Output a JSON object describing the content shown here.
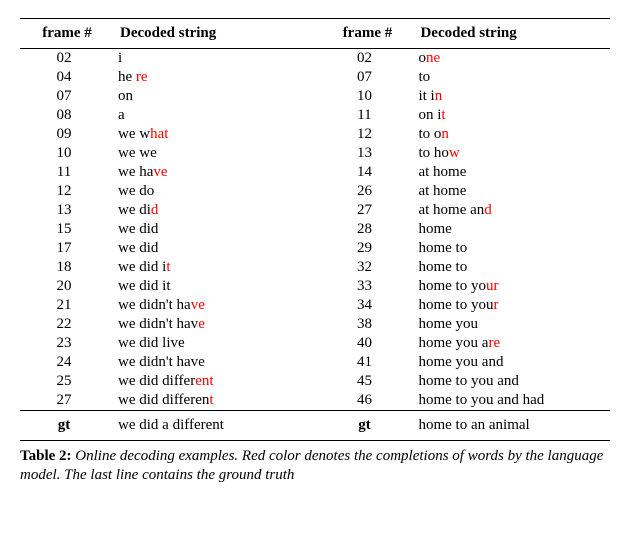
{
  "headers": {
    "frame": "frame #",
    "decoded": "Decoded string",
    "gt": "gt"
  },
  "left": [
    {
      "frame": "02",
      "parts": [
        [
          "i",
          false
        ]
      ]
    },
    {
      "frame": "04",
      "parts": [
        [
          "he ",
          false
        ],
        [
          "re",
          true
        ]
      ]
    },
    {
      "frame": "07",
      "parts": [
        [
          "on",
          false
        ]
      ]
    },
    {
      "frame": "08",
      "parts": [
        [
          "a",
          false
        ]
      ]
    },
    {
      "frame": "09",
      "parts": [
        [
          "we w",
          false
        ],
        [
          "hat",
          true
        ]
      ]
    },
    {
      "frame": "10",
      "parts": [
        [
          "we we",
          false
        ]
      ]
    },
    {
      "frame": "11",
      "parts": [
        [
          "we ha",
          false
        ],
        [
          "ve",
          true
        ]
      ]
    },
    {
      "frame": "12",
      "parts": [
        [
          "we do",
          false
        ]
      ]
    },
    {
      "frame": "13",
      "parts": [
        [
          "we di",
          false
        ],
        [
          "d",
          true
        ]
      ]
    },
    {
      "frame": "15",
      "parts": [
        [
          "we did",
          false
        ]
      ]
    },
    {
      "frame": "17",
      "parts": [
        [
          "we did",
          false
        ]
      ]
    },
    {
      "frame": "18",
      "parts": [
        [
          "we did i",
          false
        ],
        [
          "t",
          true
        ]
      ]
    },
    {
      "frame": "20",
      "parts": [
        [
          "we did it",
          false
        ]
      ]
    },
    {
      "frame": "21",
      "parts": [
        [
          "we didn't ha",
          false
        ],
        [
          "ve",
          true
        ]
      ]
    },
    {
      "frame": "22",
      "parts": [
        [
          "we didn't hav",
          false
        ],
        [
          "e",
          true
        ]
      ]
    },
    {
      "frame": "23",
      "parts": [
        [
          "we did live",
          false
        ]
      ]
    },
    {
      "frame": "24",
      "parts": [
        [
          "we didn't have",
          false
        ]
      ]
    },
    {
      "frame": "25",
      "parts": [
        [
          "we did differ",
          false
        ],
        [
          "ent",
          true
        ]
      ]
    },
    {
      "frame": "27",
      "parts": [
        [
          "we did differen",
          false
        ],
        [
          "t",
          true
        ]
      ]
    }
  ],
  "right": [
    {
      "frame": "02",
      "parts": [
        [
          "o",
          false
        ],
        [
          "ne",
          true
        ]
      ]
    },
    {
      "frame": "07",
      "parts": [
        [
          "to",
          false
        ]
      ]
    },
    {
      "frame": "10",
      "parts": [
        [
          "it i",
          false
        ],
        [
          "n",
          true
        ]
      ]
    },
    {
      "frame": "11",
      "parts": [
        [
          "on i",
          false
        ],
        [
          "t",
          true
        ]
      ]
    },
    {
      "frame": "12",
      "parts": [
        [
          "to o",
          false
        ],
        [
          "n",
          true
        ]
      ]
    },
    {
      "frame": "13",
      "parts": [
        [
          "to ho",
          false
        ],
        [
          "w",
          true
        ]
      ]
    },
    {
      "frame": "14",
      "parts": [
        [
          "at home",
          false
        ]
      ]
    },
    {
      "frame": "26",
      "parts": [
        [
          "at home",
          false
        ]
      ]
    },
    {
      "frame": "27",
      "parts": [
        [
          "at home an",
          false
        ],
        [
          "d",
          true
        ]
      ]
    },
    {
      "frame": "28",
      "parts": [
        [
          "home",
          false
        ]
      ]
    },
    {
      "frame": "29",
      "parts": [
        [
          "home to",
          false
        ]
      ]
    },
    {
      "frame": "32",
      "parts": [
        [
          "home to",
          false
        ]
      ]
    },
    {
      "frame": "33",
      "parts": [
        [
          "home to yo",
          false
        ],
        [
          "ur",
          true
        ]
      ]
    },
    {
      "frame": "34",
      "parts": [
        [
          "home to you",
          false
        ],
        [
          "r",
          true
        ]
      ]
    },
    {
      "frame": "38",
      "parts": [
        [
          "home you",
          false
        ]
      ]
    },
    {
      "frame": "40",
      "parts": [
        [
          "home you a",
          false
        ],
        [
          "re",
          true
        ]
      ]
    },
    {
      "frame": "41",
      "parts": [
        [
          "home you and",
          false
        ]
      ]
    },
    {
      "frame": "45",
      "parts": [
        [
          "home to you and",
          false
        ]
      ]
    },
    {
      "frame": "46",
      "parts": [
        [
          "home to you and had",
          false
        ]
      ]
    }
  ],
  "gt_left": "we did a different",
  "gt_right": "home to an animal",
  "caption": {
    "label": "Table 2:",
    "text": "Online decoding examples. Red color denotes the completions of words by the language model. The last line contains the ground truth"
  },
  "chart_data": {
    "type": "table",
    "title": "Online decoding examples",
    "columns": [
      "frame #",
      "Decoded string",
      "frame #",
      "Decoded string"
    ],
    "note": "Red color denotes language-model completions; last line is ground truth",
    "rows": [
      [
        "02",
        "i",
        "02",
        "one"
      ],
      [
        "04",
        "he re",
        "07",
        "to"
      ],
      [
        "07",
        "on",
        "10",
        "it in"
      ],
      [
        "08",
        "a",
        "11",
        "on it"
      ],
      [
        "09",
        "we what",
        "12",
        "to on"
      ],
      [
        "10",
        "we we",
        "13",
        "to how"
      ],
      [
        "11",
        "we have",
        "14",
        "at home"
      ],
      [
        "12",
        "we do",
        "26",
        "at home"
      ],
      [
        "13",
        "we did",
        "27",
        "at home and"
      ],
      [
        "15",
        "we did",
        "28",
        "home"
      ],
      [
        "17",
        "we did",
        "29",
        "home to"
      ],
      [
        "18",
        "we did it",
        "32",
        "home to"
      ],
      [
        "20",
        "we did it",
        "33",
        "home to your"
      ],
      [
        "21",
        "we didn't have",
        "34",
        "home to your"
      ],
      [
        "22",
        "we didn't have",
        "38",
        "home you"
      ],
      [
        "23",
        "we did live",
        "40",
        "home you are"
      ],
      [
        "24",
        "we didn't have",
        "41",
        "home you and"
      ],
      [
        "25",
        "we did different",
        "45",
        "home to you and"
      ],
      [
        "27",
        "we did different",
        "46",
        "home to you and had"
      ]
    ],
    "ground_truth": {
      "left": "we did a different",
      "right": "home to an animal"
    }
  }
}
